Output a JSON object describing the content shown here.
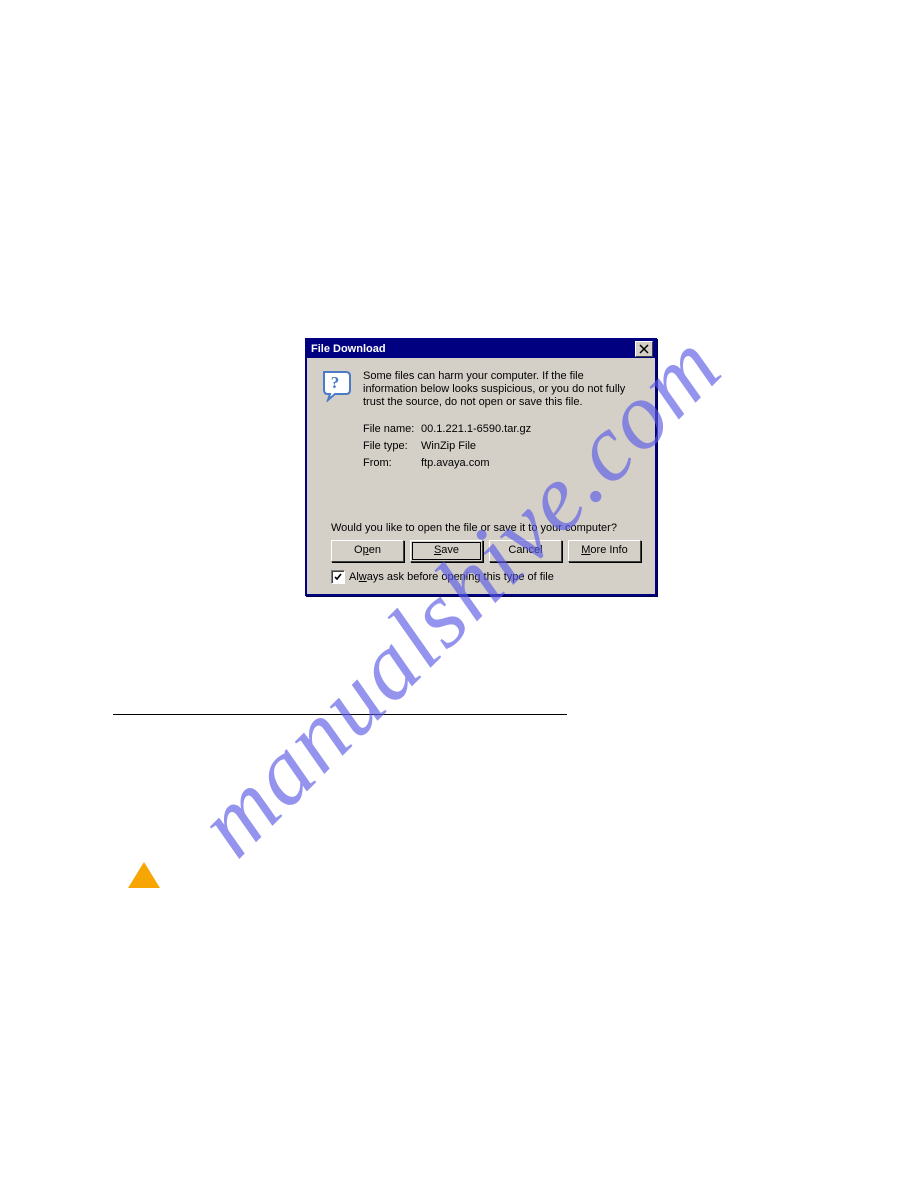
{
  "dialog": {
    "title": "File Download",
    "warning": "Some files can harm your computer. If the file information below looks suspicious, or you do not fully trust the source, do not open or save this file.",
    "filename_label": "File name:",
    "filename_value": "00.1.221.1-6590.tar.gz",
    "filetype_label": "File type:",
    "filetype_value": "WinZip File",
    "from_label": "From:",
    "from_value": "ftp.avaya.com",
    "prompt": "Would you like to open the file or save it to your computer?",
    "buttons": {
      "open_pre": "O",
      "open_u": "p",
      "open_post": "en",
      "save_u": "S",
      "save_post": "ave",
      "cancel": "Cancel",
      "more_u": "M",
      "more_post": "ore Info"
    },
    "checkbox_pre": "Al",
    "checkbox_u": "w",
    "checkbox_post": "ays ask before opening this type of file"
  },
  "watermark": "manualshive.com"
}
